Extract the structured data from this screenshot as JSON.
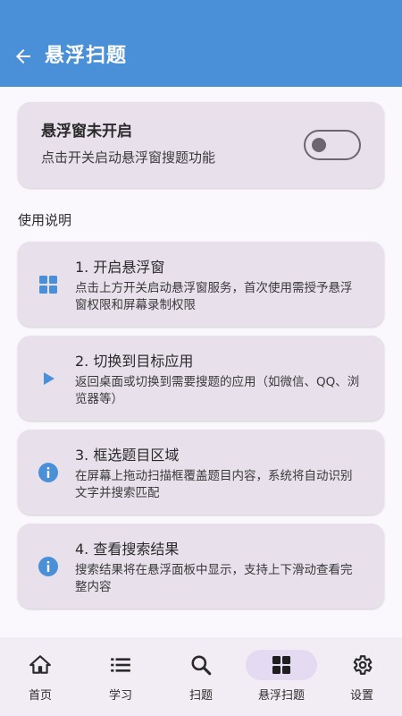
{
  "appbar": {
    "title": "悬浮扫题"
  },
  "status": {
    "title": "悬浮窗未开启",
    "subtitle": "点击开关启动悬浮窗搜题功能",
    "toggle_on": false
  },
  "section_label": "使用说明",
  "steps": [
    {
      "title": "1. 开启悬浮窗",
      "desc": "点击上方开关启动悬浮窗服务，首次使用需授予悬浮窗权限和屏幕录制权限",
      "icon": "grid-icon"
    },
    {
      "title": "2. 切换到目标应用",
      "desc": "返回桌面或切换到需要搜题的应用（如微信、QQ、浏览器等）",
      "icon": "play-icon"
    },
    {
      "title": "3. 框选题目区域",
      "desc": "在屏幕上拖动扫描框覆盖题目内容，系统将自动识别文字并搜索匹配",
      "icon": "info-icon"
    },
    {
      "title": "4. 查看搜索结果",
      "desc": "搜索结果将在悬浮面板中显示，支持上下滑动查看完整内容",
      "icon": "info-icon"
    }
  ],
  "nav": [
    {
      "label": "首页",
      "icon": "home-icon"
    },
    {
      "label": "学习",
      "icon": "list-icon"
    },
    {
      "label": "扫题",
      "icon": "search-icon"
    },
    {
      "label": "悬浮扫题",
      "icon": "grid-icon",
      "active": true
    },
    {
      "label": "设置",
      "icon": "gear-icon"
    }
  ],
  "colors": {
    "appbar": "#4a90d9",
    "accent_icon": "#4a90d9",
    "card": "#e8e1ec",
    "nav_bg": "#f2ecf4",
    "nav_active": "#e4dbf3"
  }
}
